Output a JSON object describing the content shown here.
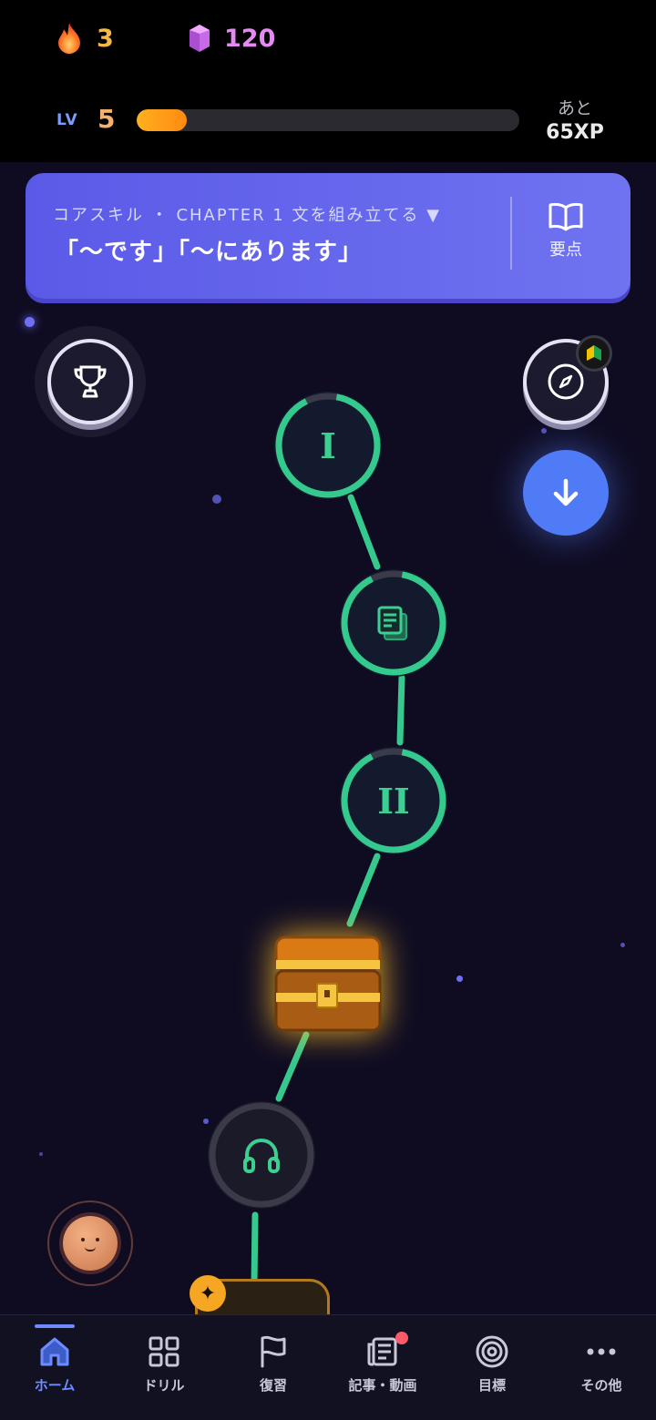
{
  "stats": {
    "streak": "3",
    "gems": "120"
  },
  "level": {
    "label": "LV",
    "value": "5",
    "progress": 0.13,
    "remaining_label": "あと",
    "remaining_xp": "65XP"
  },
  "banner": {
    "subtitle": "コアスキル ・ CHAPTER 1 文を組み立てる ▼",
    "title": "「〜です」「〜にあります」",
    "key_points_label": "要点"
  },
  "path": {
    "nodes": [
      {
        "type": "lesson",
        "glyph": "I",
        "icon": "roman-one"
      },
      {
        "type": "lesson",
        "glyph": "",
        "icon": "document-icon"
      },
      {
        "type": "lesson",
        "glyph": "II",
        "icon": "roman-two"
      },
      {
        "type": "chest",
        "icon": "treasure-chest-icon"
      },
      {
        "type": "lesson-locked",
        "icon": "headphones-icon"
      }
    ]
  },
  "colors": {
    "accent_green": "#3ccf92",
    "banner": "#5b5ae8",
    "xp_orange": "#ff9a18",
    "active_nav": "#6d8cff"
  },
  "nav": {
    "items": [
      {
        "label": "ホーム",
        "icon": "home-icon",
        "active": true
      },
      {
        "label": "ドリル",
        "icon": "grid-icon",
        "active": false
      },
      {
        "label": "復習",
        "icon": "flag-icon",
        "active": false
      },
      {
        "label": "記事・動画",
        "icon": "article-icon",
        "active": false
      },
      {
        "label": "目標",
        "icon": "target-icon",
        "active": false
      },
      {
        "label": "その他",
        "icon": "more-icon",
        "active": false
      }
    ]
  }
}
